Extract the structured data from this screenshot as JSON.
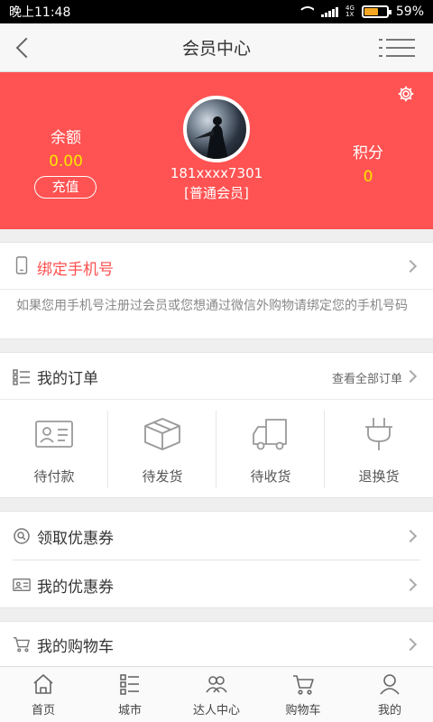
{
  "status_bar": {
    "time": "晚上11:48",
    "network_top": "4G",
    "network_bottom": "1X",
    "battery_percent": "59%",
    "battery_level": 0.59
  },
  "header": {
    "title": "会员中心"
  },
  "profile": {
    "balance_label": "余额",
    "balance_value": "0.00",
    "recharge_label": "充值",
    "phone": "181xxxx7301",
    "level": "[普通会员]",
    "points_label": "积分",
    "points_value": "0"
  },
  "bind_phone": {
    "title": "绑定手机号",
    "description": "如果您用手机号注册过会员或您想通过微信外购物请绑定您的手机号码"
  },
  "orders": {
    "title": "我的订单",
    "view_all": "查看全部订单",
    "statuses": [
      {
        "label": "待付款",
        "icon": "id-card-icon"
      },
      {
        "label": "待发货",
        "icon": "box-icon"
      },
      {
        "label": "待收货",
        "icon": "truck-icon"
      },
      {
        "label": "退换货",
        "icon": "plug-icon"
      }
    ]
  },
  "coupons": {
    "claim_label": "领取优惠券",
    "mine_label": "我的优惠券"
  },
  "cart": {
    "label": "我的购物车"
  },
  "tabbar": {
    "items": [
      {
        "label": "首页",
        "icon": "home-icon"
      },
      {
        "label": "城市",
        "icon": "list-icon"
      },
      {
        "label": "达人中心",
        "icon": "users-icon"
      },
      {
        "label": "购物车",
        "icon": "cart-icon"
      },
      {
        "label": "我的",
        "icon": "user-icon"
      }
    ]
  },
  "colors": {
    "accent_red": "#ff5252",
    "value_yellow": "#ffe600",
    "bind_title_red": "#ff4f4f"
  }
}
